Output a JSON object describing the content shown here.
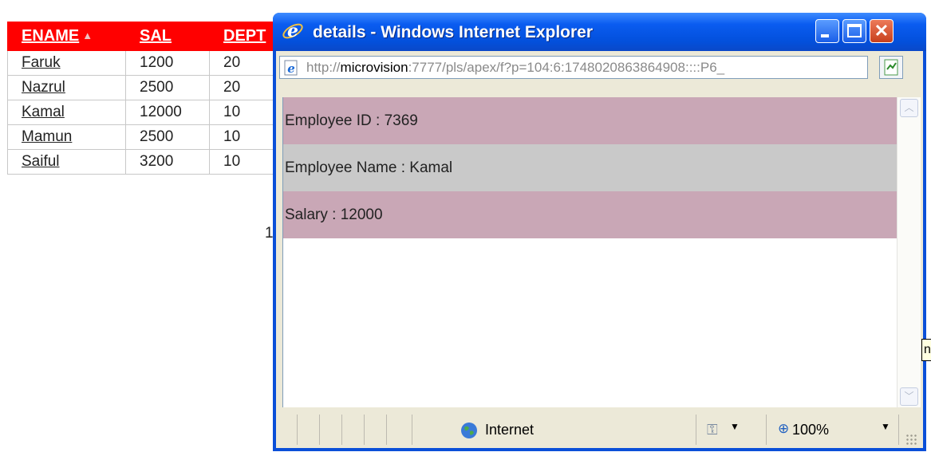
{
  "report": {
    "headers": {
      "ename": "ENAME",
      "sal": "SAL",
      "dept": "DEPT"
    },
    "sort_indicator": "▲",
    "rows": [
      {
        "ename": "Faruk",
        "sal": "1200",
        "dept": "20"
      },
      {
        "ename": "Nazrul",
        "sal": "2500",
        "dept": "20"
      },
      {
        "ename": "Kamal",
        "sal": "12000",
        "dept": "10"
      },
      {
        "ename": "Mamun",
        "sal": "2500",
        "dept": "10"
      },
      {
        "ename": "Saiful",
        "sal": "3200",
        "dept": "10"
      }
    ],
    "pagination_text": "1",
    "header_color": "#ff0000"
  },
  "window": {
    "title": "details - Windows Internet Explorer",
    "buttons": {
      "minimize": "minimize",
      "maximize": "maximize",
      "close": "✕"
    },
    "address_prefix": "http://",
    "address_host": "microvision",
    "address_rest": ":7777/pls/apex/f?p=104:6:1748020863864908::::P6_",
    "details": [
      {
        "text": "Employee ID : 7369"
      },
      {
        "text": "Employee Name : Kamal"
      },
      {
        "text": "Salary : 12000"
      }
    ],
    "status": {
      "zone": "Internet",
      "zoom": "100%"
    },
    "icons": [
      "ie-logo-icon",
      "page-icon",
      "go-icon",
      "globe-icon",
      "security-icon",
      "zoom-icon"
    ]
  },
  "tooltip_fragment": "n"
}
